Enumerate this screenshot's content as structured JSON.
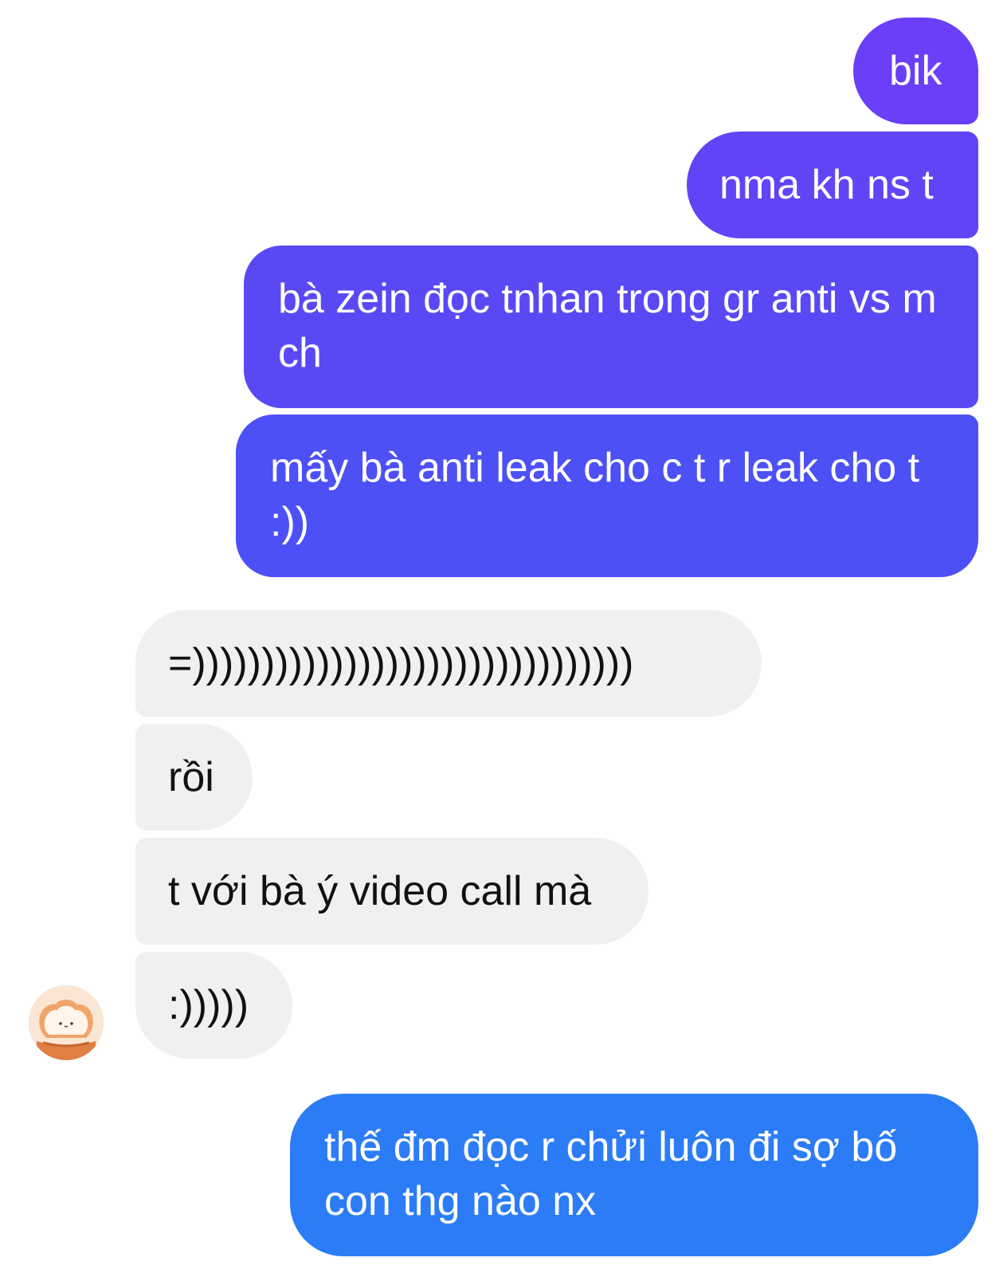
{
  "conversation": {
    "messages": [
      {
        "side": "outgoing",
        "text": "bik"
      },
      {
        "side": "outgoing",
        "text": "nma kh ns t"
      },
      {
        "side": "outgoing",
        "text": "bà zein đọc tnhan trong gr anti vs m ch"
      },
      {
        "side": "outgoing",
        "text": "mấy bà anti leak cho c t r leak cho t :))"
      },
      {
        "side": "incoming",
        "text": "=))))))))))))))))))))))))))))))))"
      },
      {
        "side": "incoming",
        "text": "rồi"
      },
      {
        "side": "incoming",
        "text": "t với bà ý video call mà"
      },
      {
        "side": "incoming",
        "text": ":)))))"
      },
      {
        "side": "outgoing",
        "text": "thế đm đọc r chửi luôn đi sợ bố con thg nào nx"
      }
    ],
    "contact_avatar": {
      "icon": "bread-bear-avatar-icon"
    }
  },
  "colors": {
    "outgoing_bubble_top": "#6a3ff7",
    "outgoing_bubble_bottom": "#2b7cf6",
    "incoming_bubble": "#f0f0f0",
    "outgoing_text": "#ffffff",
    "incoming_text": "#111111"
  }
}
